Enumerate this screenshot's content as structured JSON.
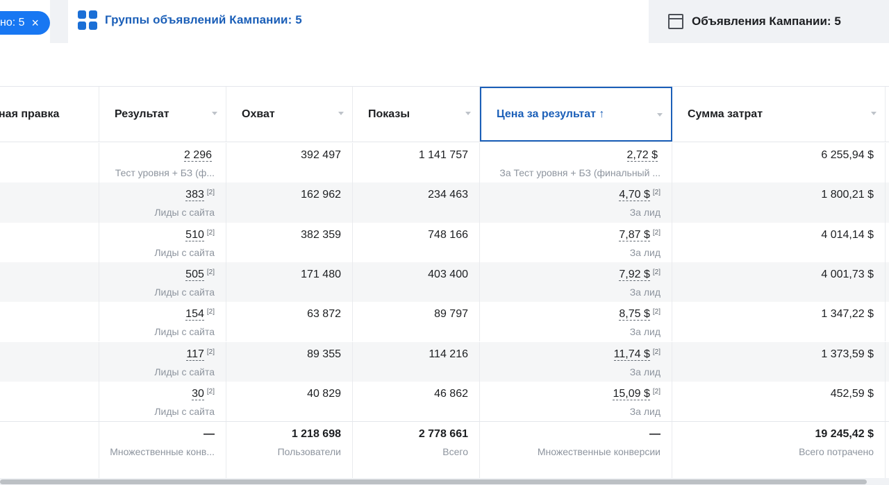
{
  "tabs": {
    "filter_chip": "но: 5",
    "filter_close": "×",
    "groups_label": "Группы объявлений Кампании: 5",
    "ads_label": "Объявления Кампании: 5"
  },
  "table": {
    "headers": [
      "ная правка",
      "Результат",
      "Охват",
      "Показы",
      "Цена за результат ↑",
      "Сумма затрат"
    ],
    "rows": [
      {
        "result": "2 296",
        "result_fn": "",
        "result_sub": "Тест уровня + БЗ (ф...",
        "reach": "392 497",
        "impr": "1 141 757",
        "cost": "2,72 $",
        "cost_fn": "",
        "cost_sub": "За Тест уровня + БЗ (финальный ...",
        "spend": "6 255,94 $"
      },
      {
        "result": "383",
        "result_fn": "[2]",
        "result_sub": "Лиды с сайта",
        "reach": "162 962",
        "impr": "234 463",
        "cost": "4,70 $",
        "cost_fn": "[2]",
        "cost_sub": "За лид",
        "spend": "1 800,21 $"
      },
      {
        "result": "510",
        "result_fn": "[2]",
        "result_sub": "Лиды с сайта",
        "reach": "382 359",
        "impr": "748 166",
        "cost": "7,87 $",
        "cost_fn": "[2]",
        "cost_sub": "За лид",
        "spend": "4 014,14 $"
      },
      {
        "result": "505",
        "result_fn": "[2]",
        "result_sub": "Лиды с сайта",
        "reach": "171 480",
        "impr": "403 400",
        "cost": "7,92 $",
        "cost_fn": "[2]",
        "cost_sub": "За лид",
        "spend": "4 001,73 $"
      },
      {
        "result": "154",
        "result_fn": "[2]",
        "result_sub": "Лиды с сайта",
        "reach": "63 872",
        "impr": "89 797",
        "cost": "8,75 $",
        "cost_fn": "[2]",
        "cost_sub": "За лид",
        "spend": "1 347,22 $"
      },
      {
        "result": "117",
        "result_fn": "[2]",
        "result_sub": "Лиды с сайта",
        "reach": "89 355",
        "impr": "114 216",
        "cost": "11,74 $",
        "cost_fn": "[2]",
        "cost_sub": "За лид",
        "spend": "1 373,59 $"
      },
      {
        "result": "30",
        "result_fn": "[2]",
        "result_sub": "Лиды с сайта",
        "reach": "40 829",
        "impr": "46 862",
        "cost": "15,09 $",
        "cost_fn": "[2]",
        "cost_sub": "За лид",
        "spend": "452,59 $"
      }
    ],
    "totals": {
      "result": "—",
      "result_sub": "Множественные конв...",
      "reach": "1 218 698",
      "reach_sub": "Пользователи",
      "impr": "2 778 661",
      "impr_sub": "Всего",
      "cost": "—",
      "cost_sub": "Множественные конверсии",
      "spend": "19 245,42 $",
      "spend_sub": "Всего потрачено"
    }
  },
  "colors": {
    "accent": "#1b5fb8",
    "chip": "#1877f2"
  }
}
